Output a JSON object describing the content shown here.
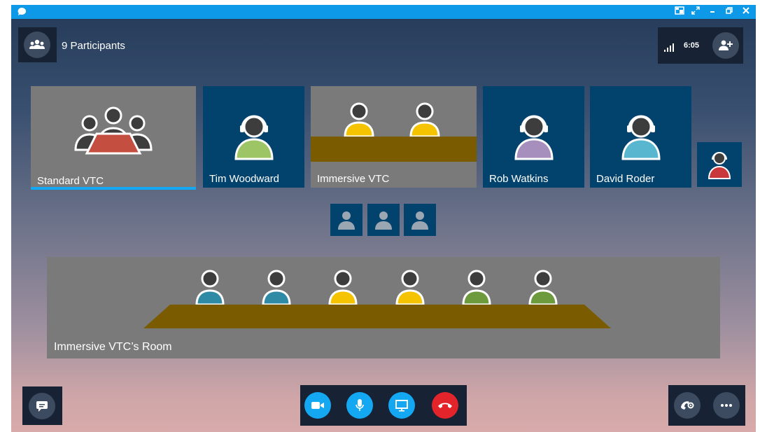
{
  "window": {
    "controls": [
      "pip-icon",
      "expand-icon",
      "minimize-icon",
      "restore-icon",
      "close-icon"
    ]
  },
  "header": {
    "participants_label": "9 Participants",
    "time": "6:05"
  },
  "tiles": [
    {
      "label": "Standard VTC",
      "kind": "group",
      "selected": true
    },
    {
      "label": "Tim Woodward",
      "kind": "person",
      "color": "#9dc465"
    },
    {
      "label": "Immersive VTC",
      "kind": "room"
    },
    {
      "label": "Rob Watkins",
      "kind": "person",
      "color": "#a68fbd"
    },
    {
      "label": "David Roder",
      "kind": "person",
      "color": "#58b7cf"
    }
  ],
  "room": {
    "label": "Immersive VTC’s Room",
    "seat_colors": [
      "#2f8aa5",
      "#2f8aa5",
      "#f6c300",
      "#f6c300",
      "#6e9a3e",
      "#6e9a3e"
    ]
  },
  "colors": {
    "accent": "#14a8f3",
    "hangup": "#e3242b",
    "table": "#7a5b00",
    "self_view_body": "#c9383a"
  },
  "controls": {
    "left": [
      "chat-icon"
    ],
    "center": [
      "video-icon",
      "mic-icon",
      "present-icon",
      "hangup-icon"
    ],
    "right": [
      "call-controls-icon",
      "more-icon"
    ]
  }
}
